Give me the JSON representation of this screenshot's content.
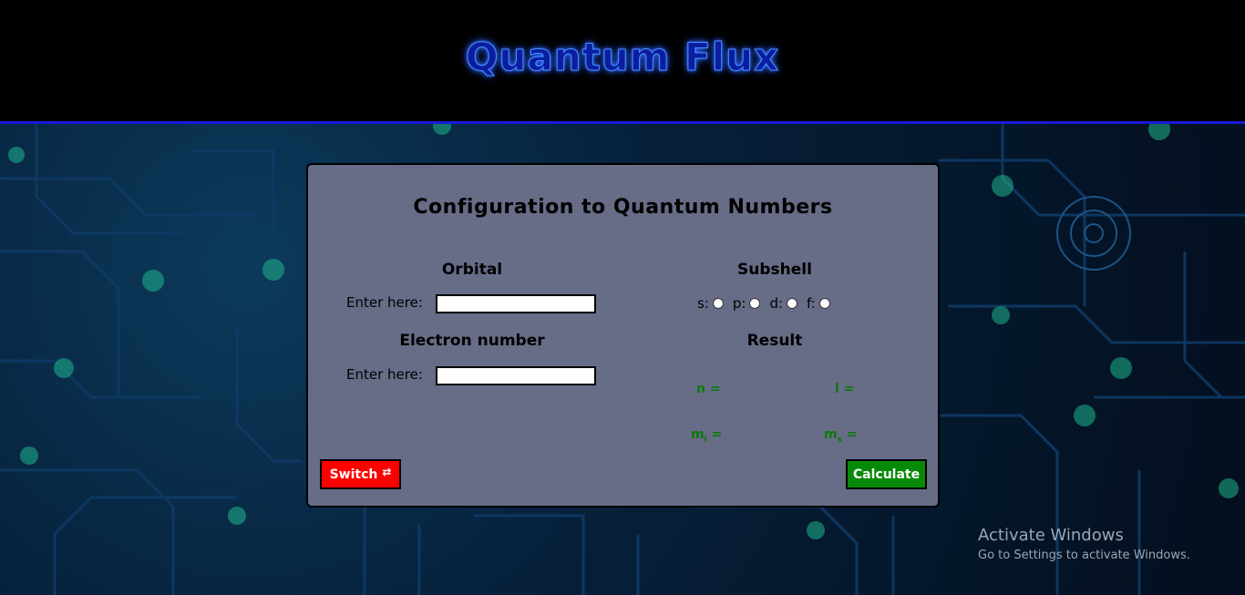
{
  "header": {
    "brand": "Quantum Flux"
  },
  "card": {
    "title": "Configuration to Quantum Numbers",
    "orbital": {
      "heading": "Orbital",
      "label": "Enter here:",
      "value": ""
    },
    "electron": {
      "heading": "Electron number",
      "label": "Enter here:",
      "value": ""
    },
    "subshell": {
      "heading": "Subshell",
      "options": [
        {
          "label": "s:"
        },
        {
          "label": "p:"
        },
        {
          "label": "d:"
        },
        {
          "label": "f:"
        }
      ]
    },
    "result": {
      "heading": "Result",
      "n": "n =",
      "l": "l =",
      "ml_main": "m",
      "ml_sub": "l",
      "ml_eq": " =",
      "ms_main": "m",
      "ms_sub": "s",
      "ms_eq": " ="
    },
    "buttons": {
      "switch": "Switch",
      "switch_icon": "⇄",
      "calculate": "Calculate"
    }
  },
  "watermark": {
    "title": "Activate Windows",
    "subtitle": "Go to Settings to activate Windows."
  },
  "colors": {
    "brand": "#0a1e9e",
    "card": "#676c87",
    "switch": "#ff0000",
    "calculate": "#078a07",
    "result": "#0a7a0a"
  }
}
